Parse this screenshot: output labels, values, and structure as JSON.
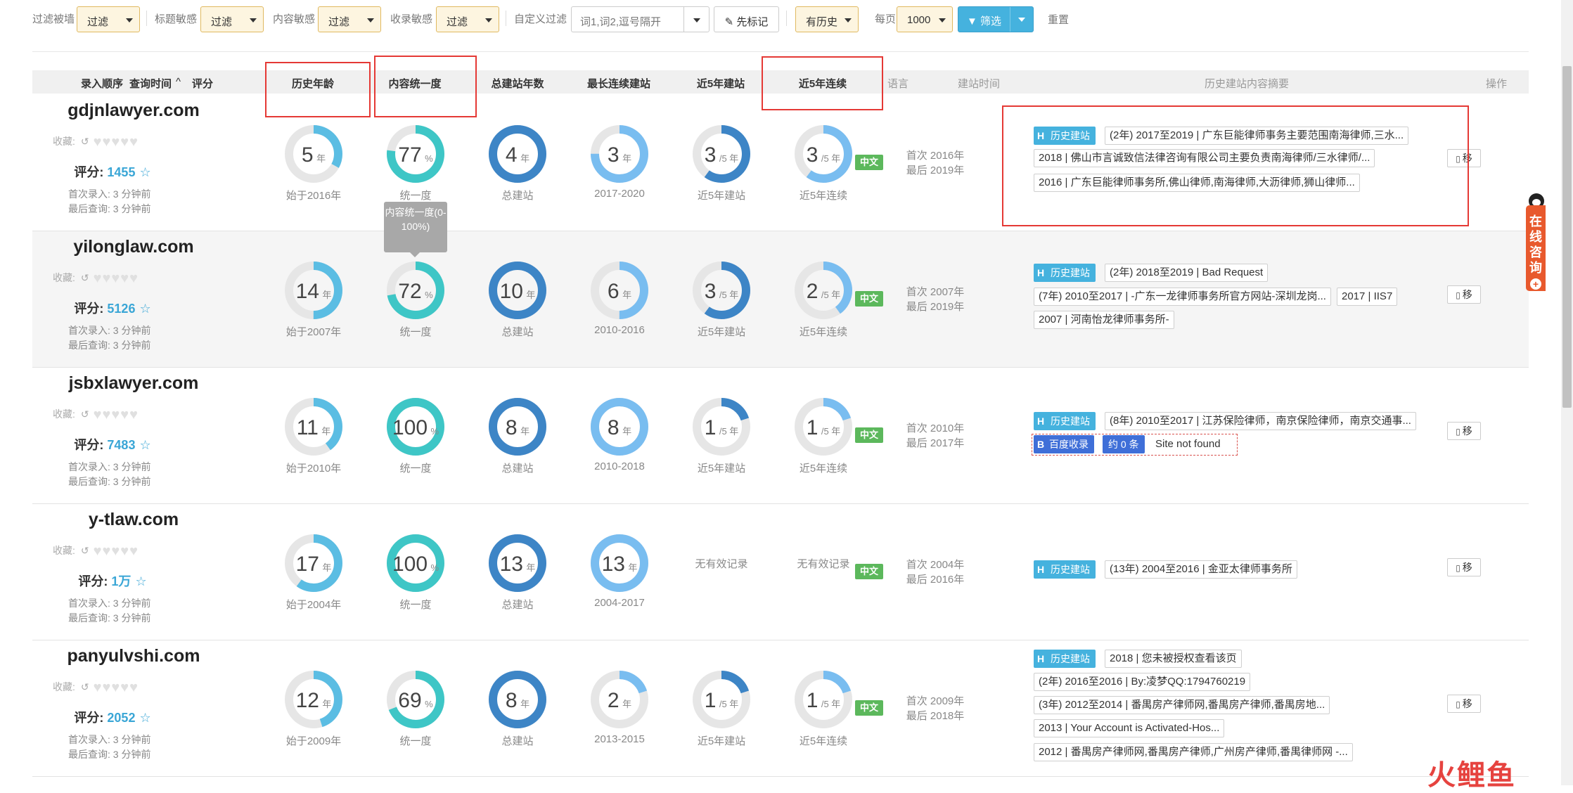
{
  "filters": {
    "wall": {
      "label": "过滤被墙",
      "value": "过滤"
    },
    "title": {
      "label": "标题敏感",
      "value": "过滤"
    },
    "content": {
      "label": "内容敏感",
      "value": "过滤"
    },
    "index": {
      "label": "收录敏感",
      "value": "过滤"
    },
    "custom": {
      "label": "自定义过滤",
      "placeholder": "词1,词2,逗号隔开"
    },
    "mark_button": "先标记",
    "history_select": "有历史",
    "per_page": {
      "label": "每页",
      "value": "1000"
    },
    "filter_button": "筛选",
    "reset_link": "重置"
  },
  "columns": {
    "order": "录入顺序",
    "query_time": "查询时间",
    "score": "评分",
    "history_age": "历史年龄",
    "consistency": "内容统一度",
    "total_years": "总建站年数",
    "longest": "最长连续建站",
    "recent_built": "近5年建站",
    "recent_cont": "近5年连续",
    "language": "语言",
    "site_time": "建站时间",
    "summary": "历史建站内容摘要",
    "action": "操作"
  },
  "common": {
    "fav_label": "收藏:",
    "score_label": "评分:",
    "first_prefix": "首次录入:",
    "last_prefix": "最后查询:",
    "first_built_prefix": "首次",
    "last_built_prefix": "最后",
    "lang": "中文",
    "move": "移",
    "history_tag": "历史建站",
    "baidu_tag": "百度收录",
    "no_record": "无有效记录",
    "unit_year": "年",
    "unit_pct": "%",
    "unit_of5": "/5 年",
    "cap_consistency": "统一度",
    "cap_total": "总建站",
    "cap_recent": "近5年建站",
    "cap_recent_cont": "近5年连续"
  },
  "tooltip": "内容统一度(0-100%)",
  "rows": [
    {
      "domain": "gdjnlawyer.com",
      "score": "1455",
      "first_entry": "3 分钟前",
      "last_query": "3 分钟前",
      "age": {
        "value": 5,
        "fraction": 0.33,
        "caption": "始于2016年"
      },
      "consistency": {
        "value": 77,
        "fraction": 0.77
      },
      "total": {
        "value": 4,
        "fraction": 1.0
      },
      "longest": {
        "value": 3,
        "fraction": 0.75,
        "caption": "2017-2020"
      },
      "recent_built": {
        "value": 3,
        "fraction": 0.6
      },
      "recent_cont": {
        "value": 3,
        "fraction": 0.6
      },
      "first_built": "2016年",
      "last_built": "2019年",
      "summaries": [
        "(2年) 2017至2019 | 广东巨能律师事务主要范围南海律师,三水...",
        "2018 | 佛山市言诚致信法律咨询有限公司主要负责南海律师/三水律师/...",
        "2016 | 广东巨能律师事务所,佛山律师,南海律师,大沥律师,狮山律师..."
      ]
    },
    {
      "domain": "yilonglaw.com",
      "score": "5126",
      "first_entry": "3 分钟前",
      "last_query": "3 分钟前",
      "age": {
        "value": 14,
        "fraction": 0.5,
        "caption": "始于2007年"
      },
      "consistency": {
        "value": 72,
        "fraction": 0.72
      },
      "total": {
        "value": 10,
        "fraction": 1.0
      },
      "longest": {
        "value": 6,
        "fraction": 0.5,
        "caption": "2010-2016"
      },
      "recent_built": {
        "value": 3,
        "fraction": 0.6
      },
      "recent_cont": {
        "value": 2,
        "fraction": 0.4
      },
      "first_built": "2007年",
      "last_built": "2019年",
      "summaries": [
        "(2年) 2018至2019 | Bad Request",
        "(7年) 2010至2017 | -广东一龙律师事务所官方网站-深圳龙岗...",
        "2017 | IIS7",
        "2007 | 河南怡龙律师事务所-"
      ]
    },
    {
      "domain": "jsbxlawyer.com",
      "score": "7483",
      "first_entry": "3 分钟前",
      "last_query": "3 分钟前",
      "age": {
        "value": 11,
        "fraction": 0.4,
        "caption": "始于2010年"
      },
      "consistency": {
        "value": 100,
        "fraction": 1.0
      },
      "total": {
        "value": 8,
        "fraction": 1.0
      },
      "longest": {
        "value": 8,
        "fraction": 1.0,
        "caption": "2010-2018"
      },
      "recent_built": {
        "value": 1,
        "fraction": 0.2
      },
      "recent_cont": {
        "value": 1,
        "fraction": 0.2
      },
      "first_built": "2010年",
      "last_built": "2017年",
      "summaries": [
        "(8年) 2010至2017 | 江苏保险律师，南京保险律师，南京交通事..."
      ],
      "baidu": {
        "count": "约 0 条",
        "status": "Site not found"
      }
    },
    {
      "domain": "y-tlaw.com",
      "score": "1万",
      "first_entry": "3 分钟前",
      "last_query": "3 分钟前",
      "age": {
        "value": 17,
        "fraction": 0.6,
        "caption": "始于2004年"
      },
      "consistency": {
        "value": 100,
        "fraction": 1.0
      },
      "total": {
        "value": 13,
        "fraction": 1.0
      },
      "longest": {
        "value": 13,
        "fraction": 1.0,
        "caption": "2004-2017"
      },
      "first_built": "2004年",
      "last_built": "2016年",
      "summaries": [
        "(13年) 2004至2016 | 金亚太律师事务所"
      ]
    },
    {
      "domain": "panyulvshi.com",
      "score": "2052",
      "first_entry": "3 分钟前",
      "last_query": "3 分钟前",
      "age": {
        "value": 12,
        "fraction": 0.45,
        "caption": "始于2009年"
      },
      "consistency": {
        "value": 69,
        "fraction": 0.69
      },
      "total": {
        "value": 8,
        "fraction": 1.0
      },
      "longest": {
        "value": 2,
        "fraction": 0.2,
        "caption": "2013-2015"
      },
      "recent_built": {
        "value": 1,
        "fraction": 0.2
      },
      "recent_cont": {
        "value": 1,
        "fraction": 0.2
      },
      "first_built": "2009年",
      "last_built": "2018年",
      "summaries": [
        "2018 | 您未被授权查看该页",
        "(2年) 2016至2016 | By:凌梦QQ:1794760219",
        "(3年) 2012至2014 | 番禺房产律师网,番禺房产律师,番禺房地...",
        "2013 | Your Account is Activated-Hos...",
        "2012 | 番禺房产律师网,番禺房产律师,广州房产律师,番禺律师网 -..."
      ]
    }
  ],
  "consult_widget": "在线咨询",
  "watermark": "火鲤鱼",
  "colors": {
    "teal": "#3ec6c6",
    "sky": "#5bbde3",
    "blue": "#3d85c6",
    "light_blue": "#79bdf0",
    "track": "#e6e6e6",
    "annotation_red": "#e53935"
  }
}
